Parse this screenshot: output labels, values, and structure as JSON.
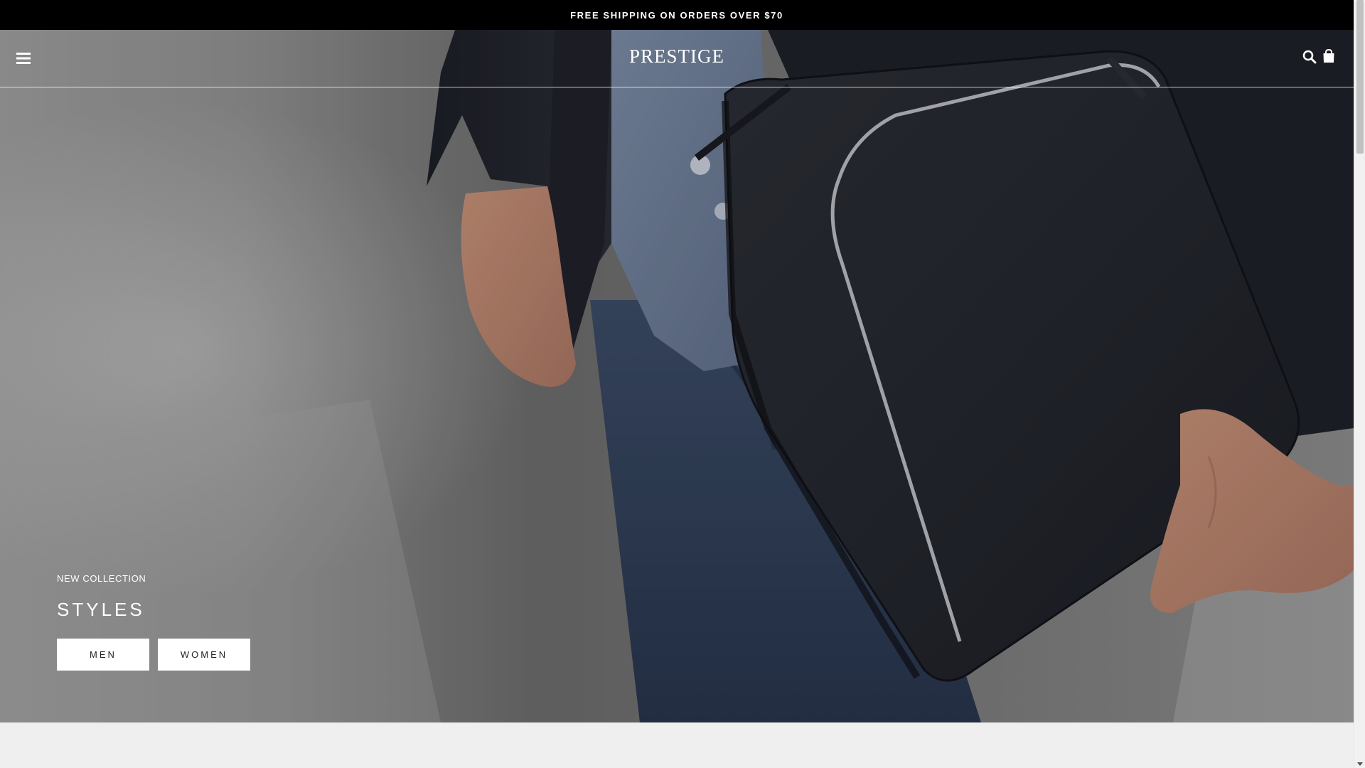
{
  "announcement": {
    "text": "FREE SHIPPING ON ORDERS OVER $70"
  },
  "header": {
    "logo": "PRESTIGE",
    "menu_icon": "hamburger-menu-icon",
    "search_icon": "search-icon",
    "cart_icon": "shopping-bag-icon"
  },
  "hero": {
    "kicker": "NEW COLLECTION",
    "headline": "STYLES",
    "buttons": [
      "MEN",
      "WOMEN"
    ],
    "image_description": "person in dark blazer and denim shirt holding black leather zip folio"
  },
  "colors": {
    "announcement_bg": "#000000",
    "button_bg": "#ffffff",
    "page_bg": "#efefef"
  }
}
